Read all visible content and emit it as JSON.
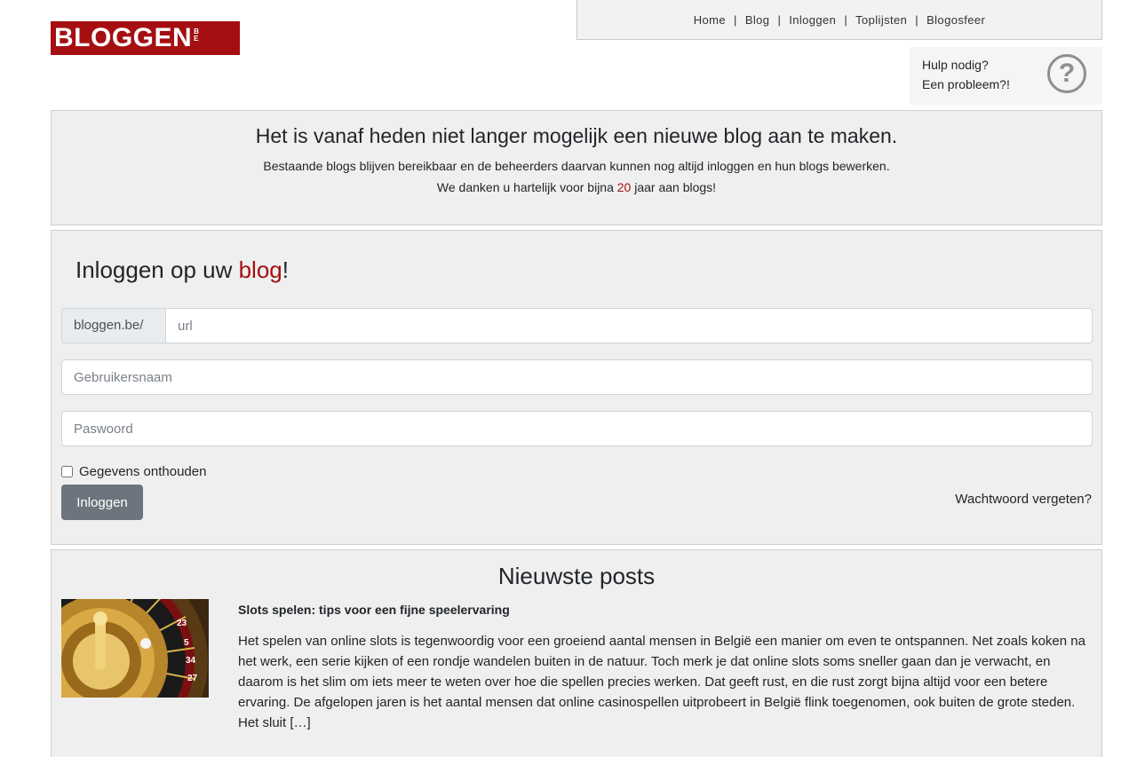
{
  "logo": {
    "text": "BLOGGEN",
    "suffix": "BE"
  },
  "nav": {
    "items": [
      "Home",
      "Blog",
      "Inloggen",
      "Toplijsten",
      "Blogosfeer"
    ],
    "separator": "|"
  },
  "help": {
    "line1": "Hulp nodig?",
    "line2": "Een probleem?!",
    "icon_glyph": "?"
  },
  "notice": {
    "title": "Het is vanaf heden niet langer mogelijk een nieuwe blog aan te maken.",
    "line1": "Bestaande blogs blijven bereikbaar en de beheerders daarvan kunnen nog altijd inloggen en hun blogs bewerken.",
    "line2_before": "We danken u hartelijk voor bijna ",
    "line2_highlight": "20",
    "line2_after": " jaar aan blogs!"
  },
  "login": {
    "title_before": "Inloggen op uw ",
    "title_highlight": "blog",
    "title_after": "!",
    "url_prefix": "bloggen.be/",
    "url_placeholder": "url",
    "username_placeholder": "Gebruikersnaam",
    "password_placeholder": "Paswoord",
    "remember_label": "Gegevens onthouden",
    "submit_label": "Inloggen",
    "forgot_label": "Wachtwoord vergeten?"
  },
  "posts": {
    "title": "Nieuwste posts",
    "items": [
      {
        "title": "Slots spelen: tips voor een fijne speelervaring",
        "excerpt": "Het spelen van online slots is tegenwoordig voor een groeiend aantal mensen in België een manier om even te ontspannen. Net zoals koken na het werk, een serie kijken of een rondje wandelen buiten in de natuur. Toch merk je dat online slots soms sneller gaan dan je verwacht, en daarom is het slim om iets meer te weten over hoe die spellen precies werken. Dat geeft rust, en die rust zorgt bijna altijd voor een betere ervaring. De afgelopen jaren is het aantal mensen dat online casinospellen uitprobeert in België flink toegenomen, ook buiten de grote steden. Het sluit […]"
      }
    ]
  },
  "colors": {
    "brand": "#a50f12",
    "button": "#6c757d",
    "panel": "#efefef"
  }
}
